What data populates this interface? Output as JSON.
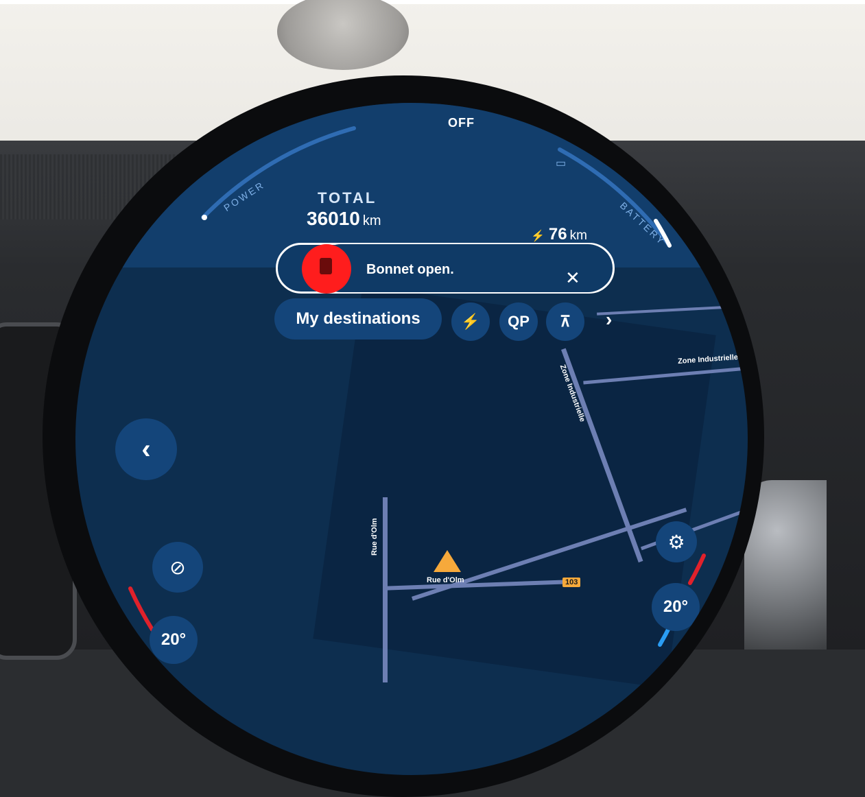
{
  "header": {
    "status": "OFF"
  },
  "gauges": {
    "power_label": "POWER",
    "battery_label": "BATTERY",
    "battery_icon": "battery-icon",
    "power_level": 0.72,
    "battery_level": 0.35
  },
  "odometer": {
    "label": "TOTAL",
    "value": "36010",
    "unit": "km"
  },
  "range": {
    "icon": "ev-plug-icon",
    "value": "76",
    "unit": "km"
  },
  "notification": {
    "text": "Bonnet open.",
    "close_icon": "close-icon",
    "icon": "bonnet-warning-icon",
    "color": "#ff1d1d"
  },
  "quick_actions": {
    "destinations_label": "My destinations",
    "charging_icon": "charging-station-icon",
    "parking_icon": "parking-search-icon",
    "picnic_icon": "picnic-area-icon",
    "more_icon": "chevron-right-icon",
    "charging_glyph": "⚡",
    "parking_glyph": "QP",
    "picnic_glyph": "⊼",
    "more_glyph": "›"
  },
  "map": {
    "streets": [
      "Zone Industrielle",
      "Zone Industrielle",
      "Rue d'Olm",
      "Rue d'Olm"
    ],
    "route_badge": "103"
  },
  "controls": {
    "back_glyph": "‹",
    "compass_glyph": "⊘",
    "settings_glyph": "⚙"
  },
  "climate": {
    "left_temp": "20°",
    "right_temp": "20°"
  },
  "colors": {
    "screen_bg": "#0d2e4f",
    "accent_red": "#e0212b",
    "accent_blue": "#2a9df4"
  }
}
